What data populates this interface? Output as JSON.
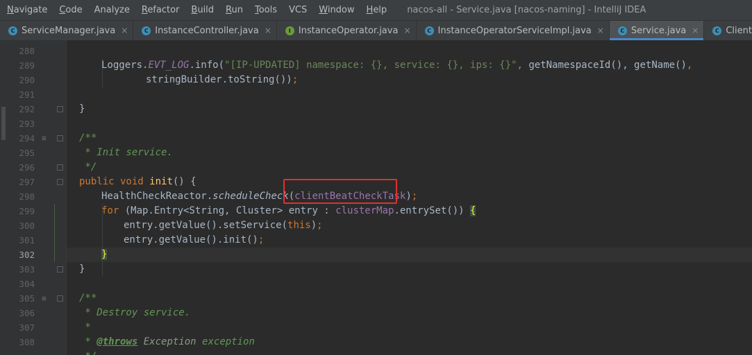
{
  "menubar": {
    "items": [
      {
        "mnemonic": "N",
        "rest": "avigate"
      },
      {
        "mnemonic": "C",
        "rest": "ode"
      },
      {
        "mnemonic": "",
        "rest": "Analyze"
      },
      {
        "mnemonic": "R",
        "rest": "efactor"
      },
      {
        "mnemonic": "B",
        "rest": "uild"
      },
      {
        "mnemonic": "R",
        "rest": "u n"
      },
      {
        "mnemonic": "T",
        "rest": "ools"
      },
      {
        "mnemonic": "",
        "rest": "VCS"
      },
      {
        "mnemonic": "W",
        "rest": "indow"
      },
      {
        "mnemonic": "H",
        "rest": "elp"
      }
    ],
    "window_title": "nacos-all - Service.java [nacos-naming] - IntelliJ IDEA"
  },
  "tabs": [
    {
      "label": "ServiceManager.java",
      "icon": "C",
      "kind": "class-icon"
    },
    {
      "label": "InstanceController.java",
      "icon": "C",
      "kind": "class-icon"
    },
    {
      "label": "InstanceOperator.java",
      "icon": "I",
      "kind": "interface-icon"
    },
    {
      "label": "InstanceOperatorServiceImpl.java",
      "icon": "C",
      "kind": "class-icon"
    },
    {
      "label": "Service.java",
      "icon": "C",
      "kind": "class-icon",
      "active": true
    },
    {
      "label": "ClientBeatCheckTask.java",
      "icon": "C",
      "kind": "class-icon"
    }
  ],
  "tab_close_glyph": "×",
  "editor": {
    "current_line": "302",
    "lines": [
      {
        "n": "288"
      },
      {
        "n": "289"
      },
      {
        "n": "290"
      },
      {
        "n": "291"
      },
      {
        "n": "292"
      },
      {
        "n": "293"
      },
      {
        "n": "294"
      },
      {
        "n": "295"
      },
      {
        "n": "296"
      },
      {
        "n": "297"
      },
      {
        "n": "298"
      },
      {
        "n": "299"
      },
      {
        "n": "300"
      },
      {
        "n": "301"
      },
      {
        "n": "302"
      },
      {
        "n": "303"
      },
      {
        "n": "304"
      },
      {
        "n": "305"
      },
      {
        "n": "306"
      },
      {
        "n": "307"
      },
      {
        "n": "308"
      }
    ],
    "code": {
      "l289_a": "Loggers.",
      "l289_b": "EVT_LOG",
      "l289_c": ".info(",
      "l289_d": "\"[IP-UPDATED] namespace: {}, service: {}, ips: {}\"",
      "l289_e": ", ",
      "l289_f": "getNamespaceId(), getName()",
      "l289_g": ",",
      "l290": "stringBuilder.toString())",
      "l290_semi": ";",
      "l292": "}",
      "l294": "/**",
      "l295": " * Init service.",
      "l296": " */",
      "l297_kw": "public void ",
      "l297_fn": "init",
      "l297_rest": "() {",
      "l298_a": "HealthCheckReactor.",
      "l298_b": "scheduleCheck",
      "l298_c": "(",
      "l298_d": "clientBeatCheckTask",
      "l298_e": ")",
      "l298_semi": ";",
      "l299_kw": "for ",
      "l299_a": "(Map.Entry<String, Cluster> entry : ",
      "l299_field": "clusterMap",
      "l299_b": ".entrySet()) ",
      "l299_brace": "{",
      "l300_a": "entry.getValue().setService(",
      "l300_kw": "this",
      "l300_b": ")",
      "l300_semi": ";",
      "l301_a": "entry.getValue().init()",
      "l301_semi": ";",
      "l302": "}",
      "l303": "}",
      "l305": "/**",
      "l306": " * Destroy service.",
      "l307": " *",
      "l308_star": " * ",
      "l308_tag": "@throws",
      "l308_ref": " Exception",
      "l308_text": " exception",
      "l309": " */"
    }
  },
  "colors": {
    "highlight_box": "#e3302f",
    "active_tab_underline": "#4a88c7"
  }
}
